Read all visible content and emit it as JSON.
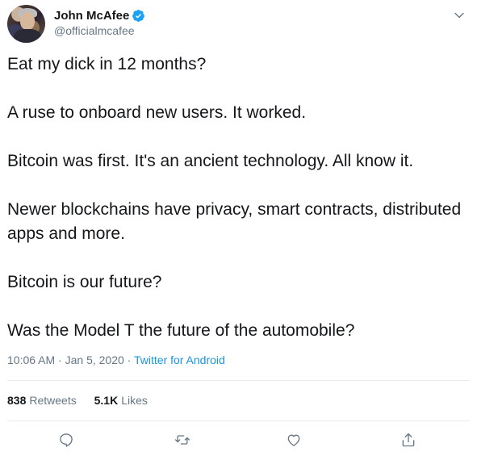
{
  "author": {
    "display_name": "John McAfee",
    "handle": "@officialmcafee",
    "verified": true
  },
  "tweet": {
    "paragraphs": [
      "Eat my dick in 12 months?",
      "A ruse to onboard new users. It worked.",
      "Bitcoin was first. It's an ancient technology.  All know it.",
      "Newer blockchains have privacy, smart contracts, distributed apps and more.",
      "Bitcoin is our future?",
      "Was the Model T the future of the automobile?"
    ],
    "time": "10:06 AM",
    "date": "Jan 5, 2020",
    "separator": " · ",
    "source": "Twitter for Android"
  },
  "stats": {
    "retweets_count": "838",
    "retweets_label": "Retweets",
    "likes_count": "5.1K",
    "likes_label": "Likes"
  },
  "icons": {
    "verified": "verified-badge-icon",
    "more": "chevron-down-icon",
    "reply": "reply-icon",
    "retweet": "retweet-icon",
    "like": "heart-icon",
    "share": "share-icon"
  },
  "colors": {
    "text": "#14171a",
    "secondary": "#657786",
    "link": "#1b95e0",
    "verified": "#1da1f2",
    "border": "#e6ecf0"
  }
}
